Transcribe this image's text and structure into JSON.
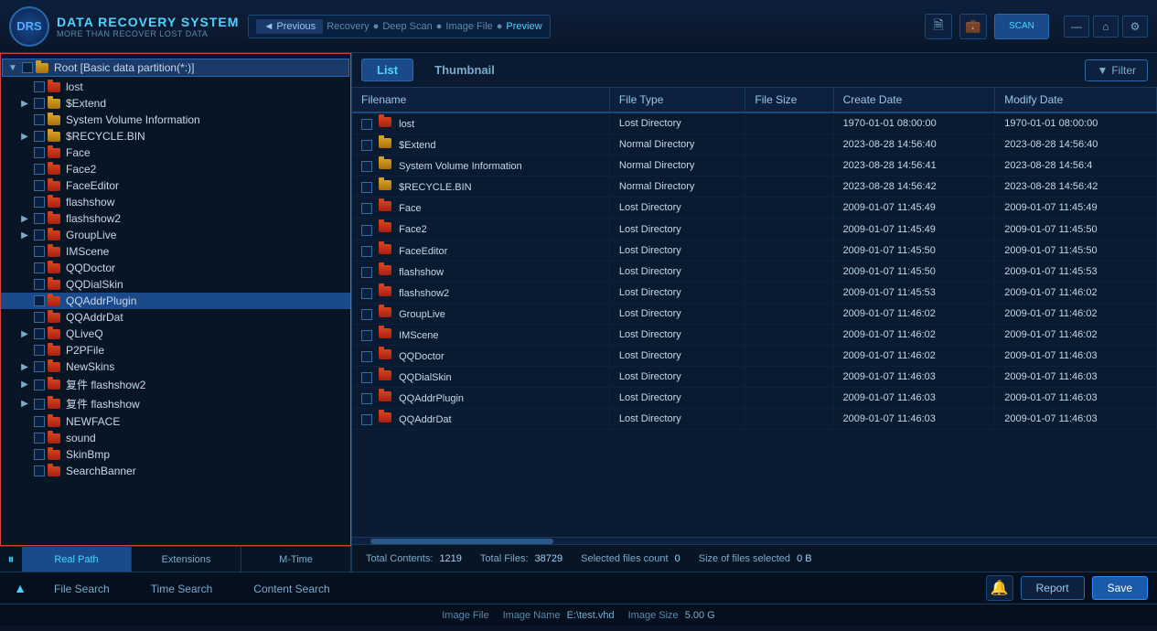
{
  "app": {
    "title": "DATA RECOVERY SYSTEM",
    "subtitle": "MORE THAN RECOVER LOST DATA",
    "logo_text": "DRS"
  },
  "nav": {
    "prev_label": "◄ Previous",
    "steps": [
      "Recovery",
      "Deep Scan",
      "Image File",
      "Preview"
    ]
  },
  "header": {
    "icons": [
      "copy-icon",
      "briefcase-icon"
    ],
    "active_btn_label": "scan"
  },
  "window_controls": {
    "minimize": "—",
    "home": "⌂",
    "settings": "⚙"
  },
  "sidebar": {
    "root_label": "Root [Basic data partition(*:)]",
    "items": [
      {
        "label": "lost",
        "type": "lost",
        "indent": 1,
        "expandable": false
      },
      {
        "label": "$Extend",
        "type": "normal",
        "indent": 1,
        "expandable": true
      },
      {
        "label": "System Volume Information",
        "type": "normal",
        "indent": 1,
        "expandable": false
      },
      {
        "label": "$RECYCLE.BIN",
        "type": "normal",
        "indent": 1,
        "expandable": true
      },
      {
        "label": "Face",
        "type": "lost",
        "indent": 1,
        "expandable": false
      },
      {
        "label": "Face2",
        "type": "lost",
        "indent": 1,
        "expandable": false
      },
      {
        "label": "FaceEditor",
        "type": "lost",
        "indent": 1,
        "expandable": false
      },
      {
        "label": "flashshow",
        "type": "lost",
        "indent": 1,
        "expandable": false
      },
      {
        "label": "flashshow2",
        "type": "lost",
        "indent": 1,
        "expandable": true
      },
      {
        "label": "GroupLive",
        "type": "lost",
        "indent": 1,
        "expandable": true
      },
      {
        "label": "IMScene",
        "type": "lost",
        "indent": 1,
        "expandable": false
      },
      {
        "label": "QQDoctor",
        "type": "lost",
        "indent": 1,
        "expandable": false
      },
      {
        "label": "QQDialSkin",
        "type": "lost",
        "indent": 1,
        "expandable": false
      },
      {
        "label": "QQAddrPlugin",
        "type": "lost",
        "indent": 1,
        "expandable": false,
        "selected": true
      },
      {
        "label": "QQAddrDat",
        "type": "lost",
        "indent": 1,
        "expandable": false
      },
      {
        "label": "QLiveQ",
        "type": "lost",
        "indent": 1,
        "expandable": true
      },
      {
        "label": "P2PFile",
        "type": "lost",
        "indent": 1,
        "expandable": false
      },
      {
        "label": "NewSkins",
        "type": "lost",
        "indent": 1,
        "expandable": true
      },
      {
        "label": "复件 flashshow2",
        "type": "lost",
        "indent": 1,
        "expandable": true
      },
      {
        "label": "复件 flashshow",
        "type": "lost",
        "indent": 1,
        "expandable": true
      },
      {
        "label": "NEWFACE",
        "type": "lost",
        "indent": 1,
        "expandable": false
      },
      {
        "label": "sound",
        "type": "lost",
        "indent": 1,
        "expandable": false
      },
      {
        "label": "SkinBmp",
        "type": "lost",
        "indent": 1,
        "expandable": false
      },
      {
        "label": "SearchBanner",
        "type": "lost",
        "indent": 1,
        "expandable": false
      }
    ],
    "tabs": [
      {
        "label": "Real Path",
        "active": true
      },
      {
        "label": "Extensions",
        "active": false
      },
      {
        "label": "M-Time",
        "active": false
      }
    ]
  },
  "content": {
    "view_tabs": [
      {
        "label": "List",
        "active": true
      },
      {
        "label": "Thumbnail",
        "active": false
      }
    ],
    "filter_label": "Filter",
    "columns": [
      "Filename",
      "File Type",
      "File Size",
      "Create Date",
      "Modify Date"
    ],
    "rows": [
      {
        "name": "lost",
        "type": "Lost Directory",
        "size": "",
        "create": "1970-01-01 08:00:00",
        "modify": "1970-01-01 08:00:00",
        "folder_type": "lost"
      },
      {
        "name": "$Extend",
        "type": "Normal Directory",
        "size": "",
        "create": "2023-08-28 14:56:40",
        "modify": "2023-08-28 14:56:40",
        "folder_type": "normal"
      },
      {
        "name": "System Volume Information",
        "type": "Normal Directory",
        "size": "",
        "create": "2023-08-28 14:56:41",
        "modify": "2023-08-28 14:56:4",
        "folder_type": "normal"
      },
      {
        "name": "$RECYCLE.BIN",
        "type": "Normal Directory",
        "size": "",
        "create": "2023-08-28 14:56:42",
        "modify": "2023-08-28 14:56:42",
        "folder_type": "normal"
      },
      {
        "name": "Face",
        "type": "Lost Directory",
        "size": "",
        "create": "2009-01-07 11:45:49",
        "modify": "2009-01-07 11:45:49",
        "folder_type": "lost"
      },
      {
        "name": "Face2",
        "type": "Lost Directory",
        "size": "",
        "create": "2009-01-07 11:45:49",
        "modify": "2009-01-07 11:45:50",
        "folder_type": "lost"
      },
      {
        "name": "FaceEditor",
        "type": "Lost Directory",
        "size": "",
        "create": "2009-01-07 11:45:50",
        "modify": "2009-01-07 11:45:50",
        "folder_type": "lost"
      },
      {
        "name": "flashshow",
        "type": "Lost Directory",
        "size": "",
        "create": "2009-01-07 11:45:50",
        "modify": "2009-01-07 11:45:53",
        "folder_type": "lost"
      },
      {
        "name": "flashshow2",
        "type": "Lost Directory",
        "size": "",
        "create": "2009-01-07 11:45:53",
        "modify": "2009-01-07 11:46:02",
        "folder_type": "lost"
      },
      {
        "name": "GroupLive",
        "type": "Lost Directory",
        "size": "",
        "create": "2009-01-07 11:46:02",
        "modify": "2009-01-07 11:46:02",
        "folder_type": "lost"
      },
      {
        "name": "IMScene",
        "type": "Lost Directory",
        "size": "",
        "create": "2009-01-07 11:46:02",
        "modify": "2009-01-07 11:46:02",
        "folder_type": "lost"
      },
      {
        "name": "QQDoctor",
        "type": "Lost Directory",
        "size": "",
        "create": "2009-01-07 11:46:02",
        "modify": "2009-01-07 11:46:03",
        "folder_type": "lost"
      },
      {
        "name": "QQDialSkin",
        "type": "Lost Directory",
        "size": "",
        "create": "2009-01-07 11:46:03",
        "modify": "2009-01-07 11:46:03",
        "folder_type": "lost"
      },
      {
        "name": "QQAddrPlugin",
        "type": "Lost Directory",
        "size": "",
        "create": "2009-01-07 11:46:03",
        "modify": "2009-01-07 11:46:03",
        "folder_type": "lost"
      },
      {
        "name": "QQAddrDat",
        "type": "Lost Directory",
        "size": "",
        "create": "2009-01-07 11:46:03",
        "modify": "2009-01-07 11:46:03",
        "folder_type": "lost"
      }
    ]
  },
  "status": {
    "total_contents_label": "Total Contents:",
    "total_contents_value": "1219",
    "total_files_label": "Total Files:",
    "total_files_value": "38729",
    "selected_count_label": "Selected files count",
    "selected_count_value": "0",
    "size_label": "Size of files  selected",
    "size_value": "0 B"
  },
  "bottom": {
    "search_tabs": [
      {
        "label": "File Search",
        "active": false
      },
      {
        "label": "Time Search",
        "active": false
      },
      {
        "label": "Content Search",
        "active": false
      }
    ],
    "report_label": "Report",
    "save_label": "Save"
  },
  "footer": {
    "image_file_label": "Image File",
    "image_name_label": "Image Name",
    "image_name_value": "E:\\test.vhd",
    "image_size_label": "Image Size",
    "image_size_value": "5.00 G"
  }
}
